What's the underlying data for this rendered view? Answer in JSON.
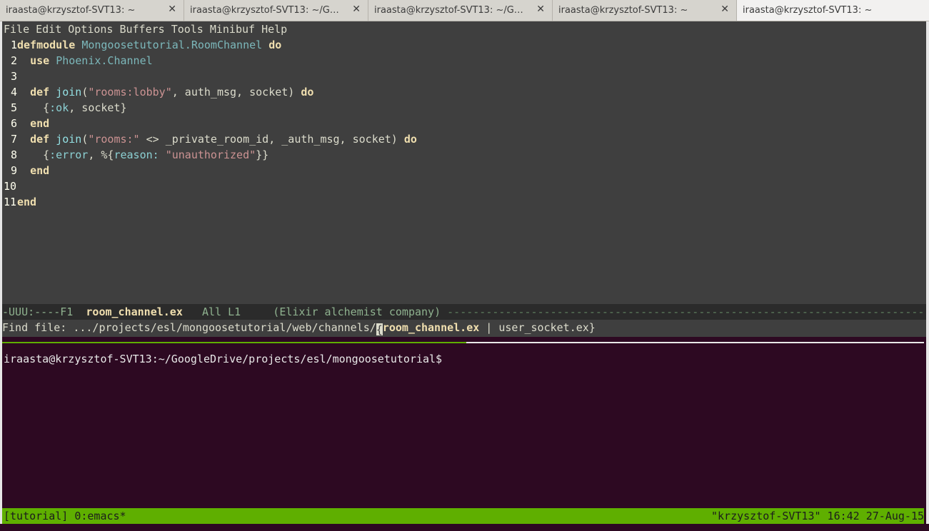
{
  "tabs": [
    {
      "label": "iraasta@krzysztof-SVT13: ~",
      "active": false
    },
    {
      "label": "iraasta@krzysztof-SVT13: ~/G…",
      "active": false
    },
    {
      "label": "iraasta@krzysztof-SVT13: ~/G…",
      "active": false
    },
    {
      "label": "iraasta@krzysztof-SVT13: ~",
      "active": false
    },
    {
      "label": "iraasta@krzysztof-SVT13: ~",
      "active": true
    }
  ],
  "tab_close_glyph": "✕",
  "menubar": [
    "File",
    "Edit",
    "Options",
    "Buffers",
    "Tools",
    "Minibuf",
    "Help"
  ],
  "code": {
    "l1": {
      "n": "1",
      "kw": "defmodule",
      "mod": "Mongoosetutorial.RoomChannel",
      "kw2": "do"
    },
    "l2": {
      "n": "2",
      "kw": "use",
      "mod": "Phoenix.Channel"
    },
    "l3": {
      "n": "3"
    },
    "l4": {
      "n": "4",
      "kw": "def",
      "fn": "join",
      "open": "(",
      "str": "\"rooms:lobby\"",
      "rest": ", auth_msg, socket)",
      "kw2": "do"
    },
    "l5": {
      "n": "5",
      "open": "{",
      "atom": ":ok",
      "rest": ", socket}"
    },
    "l6": {
      "n": "6",
      "kw": "end"
    },
    "l7": {
      "n": "7",
      "kw": "def",
      "fn": "join",
      "open": "(",
      "str": "\"rooms:\"",
      "rest": " <> _private_room_id, _auth_msg, socket)",
      "kw2": "do"
    },
    "l8": {
      "n": "8",
      "open": "{",
      "atom": ":error",
      "mid": ", %{",
      "atom2": "reason:",
      "space": " ",
      "str": "\"unauthorized\"",
      "rest": "}}"
    },
    "l9": {
      "n": "9",
      "kw": "end"
    },
    "l10": {
      "n": "10"
    },
    "l11": {
      "n": "11",
      "kw": "end"
    }
  },
  "modeline": {
    "prefix": "-UUU:----F1  ",
    "buffer": "room_channel.ex",
    "pos": "   All L1     (Elixir alchemist company) ",
    "dashes": "------------------------------------------------------------------------------------------"
  },
  "minibuffer": {
    "prompt": "Find file: .../projects/esl/mongoosetutorial/web/channels/",
    "cursor_char": "{",
    "selected": "room_channel.ex",
    "rest": " | user_socket.ex}"
  },
  "shell": {
    "prompt": "iraasta@krzysztof-SVT13:~/GoogleDrive/projects/esl/mongoosetutorial$"
  },
  "tmux": {
    "left": "[tutorial] 0:emacs*",
    "right": "\"krzysztof-SVT13\" 16:42 27-Aug-15"
  },
  "colors": {
    "emacs_bg": "#3f3f3f",
    "terminal_bg": "#2d0922",
    "tmux_status": "#5faf00",
    "keyword": "#f0dfaf",
    "string": "#cc9393"
  }
}
